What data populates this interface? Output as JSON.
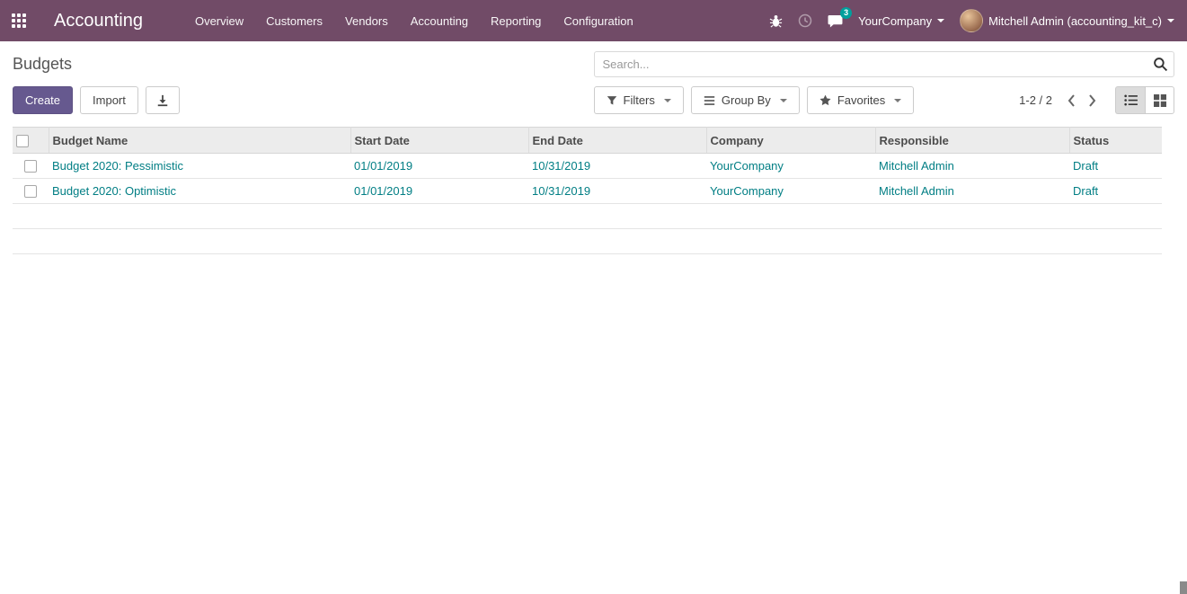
{
  "navbar": {
    "app_title": "Accounting",
    "menu": [
      "Overview",
      "Customers",
      "Vendors",
      "Accounting",
      "Reporting",
      "Configuration"
    ],
    "message_badge": "3",
    "company_switcher": "YourCompany",
    "user_name": "Mitchell Admin (accounting_kit_c)"
  },
  "control_panel": {
    "title": "Budgets",
    "search_placeholder": "Search...",
    "create_label": "Create",
    "import_label": "Import",
    "filters_label": "Filters",
    "group_by_label": "Group By",
    "favorites_label": "Favorites",
    "pager": "1-2 / 2"
  },
  "table": {
    "headers": [
      "Budget Name",
      "Start Date",
      "End Date",
      "Company",
      "Responsible",
      "Status"
    ],
    "rows": [
      {
        "budget_name": "Budget 2020: Pessimistic",
        "start_date": "01/01/2019",
        "end_date": "10/31/2019",
        "company": "YourCompany",
        "responsible": "Mitchell Admin",
        "status": "Draft"
      },
      {
        "budget_name": "Budget 2020: Optimistic",
        "start_date": "01/01/2019",
        "end_date": "10/31/2019",
        "company": "YourCompany",
        "responsible": "Mitchell Admin",
        "status": "Draft"
      }
    ]
  },
  "icons": {
    "apps_menu": "3x3-grid",
    "debug": "bug",
    "activities": "clock",
    "messages": "chat-bubble",
    "search": "magnifier",
    "export": "download-arrow",
    "filters": "funnel",
    "group_by": "bars",
    "favorites": "star",
    "pager_previous": "chevron-left",
    "pager_next": "chevron-right",
    "list_view": "list",
    "kanban_view": "grid-2x2"
  },
  "colors": {
    "navbar_bg": "#714B67",
    "primary_button": "#66598F",
    "link_teal": "#017E84",
    "badge_teal": "#00A09D",
    "header_bg": "#ECECEC"
  }
}
